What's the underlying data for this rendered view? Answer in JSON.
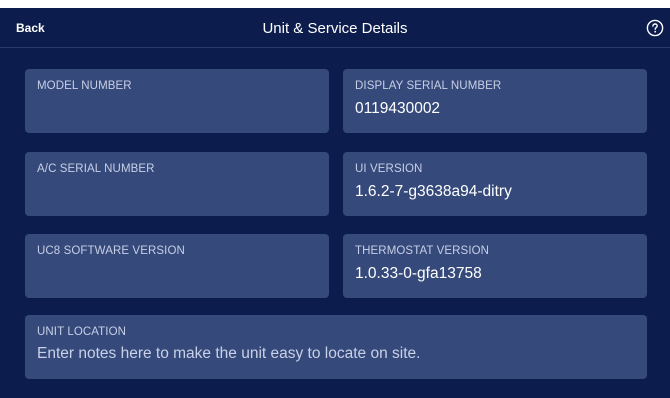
{
  "header": {
    "back_label": "Back",
    "title": "Unit & Service Details",
    "help_icon": "help-circle-icon"
  },
  "fields": {
    "model_number": {
      "label": "MODEL NUMBER",
      "value": ""
    },
    "display_serial": {
      "label": "DISPLAY SERIAL NUMBER",
      "value": "0119430002"
    },
    "ac_serial": {
      "label": "A/C SERIAL NUMBER",
      "value": ""
    },
    "ui_version": {
      "label": "UI VERSION",
      "value": "1.6.2-7-g3638a94-ditry"
    },
    "uc8_software": {
      "label": "UC8 SOFTWARE VERSION",
      "value": ""
    },
    "thermostat_version": {
      "label": "THERMOSTAT VERSION",
      "value": "1.0.33-0-gfa13758"
    },
    "unit_location": {
      "label": "UNIT LOCATION",
      "placeholder": "Enter notes here to make the unit easy to locate on site."
    }
  },
  "colors": {
    "background": "#0c1d4d",
    "card": "#35497a",
    "label": "#c7cfe6",
    "value": "#ffffff"
  }
}
